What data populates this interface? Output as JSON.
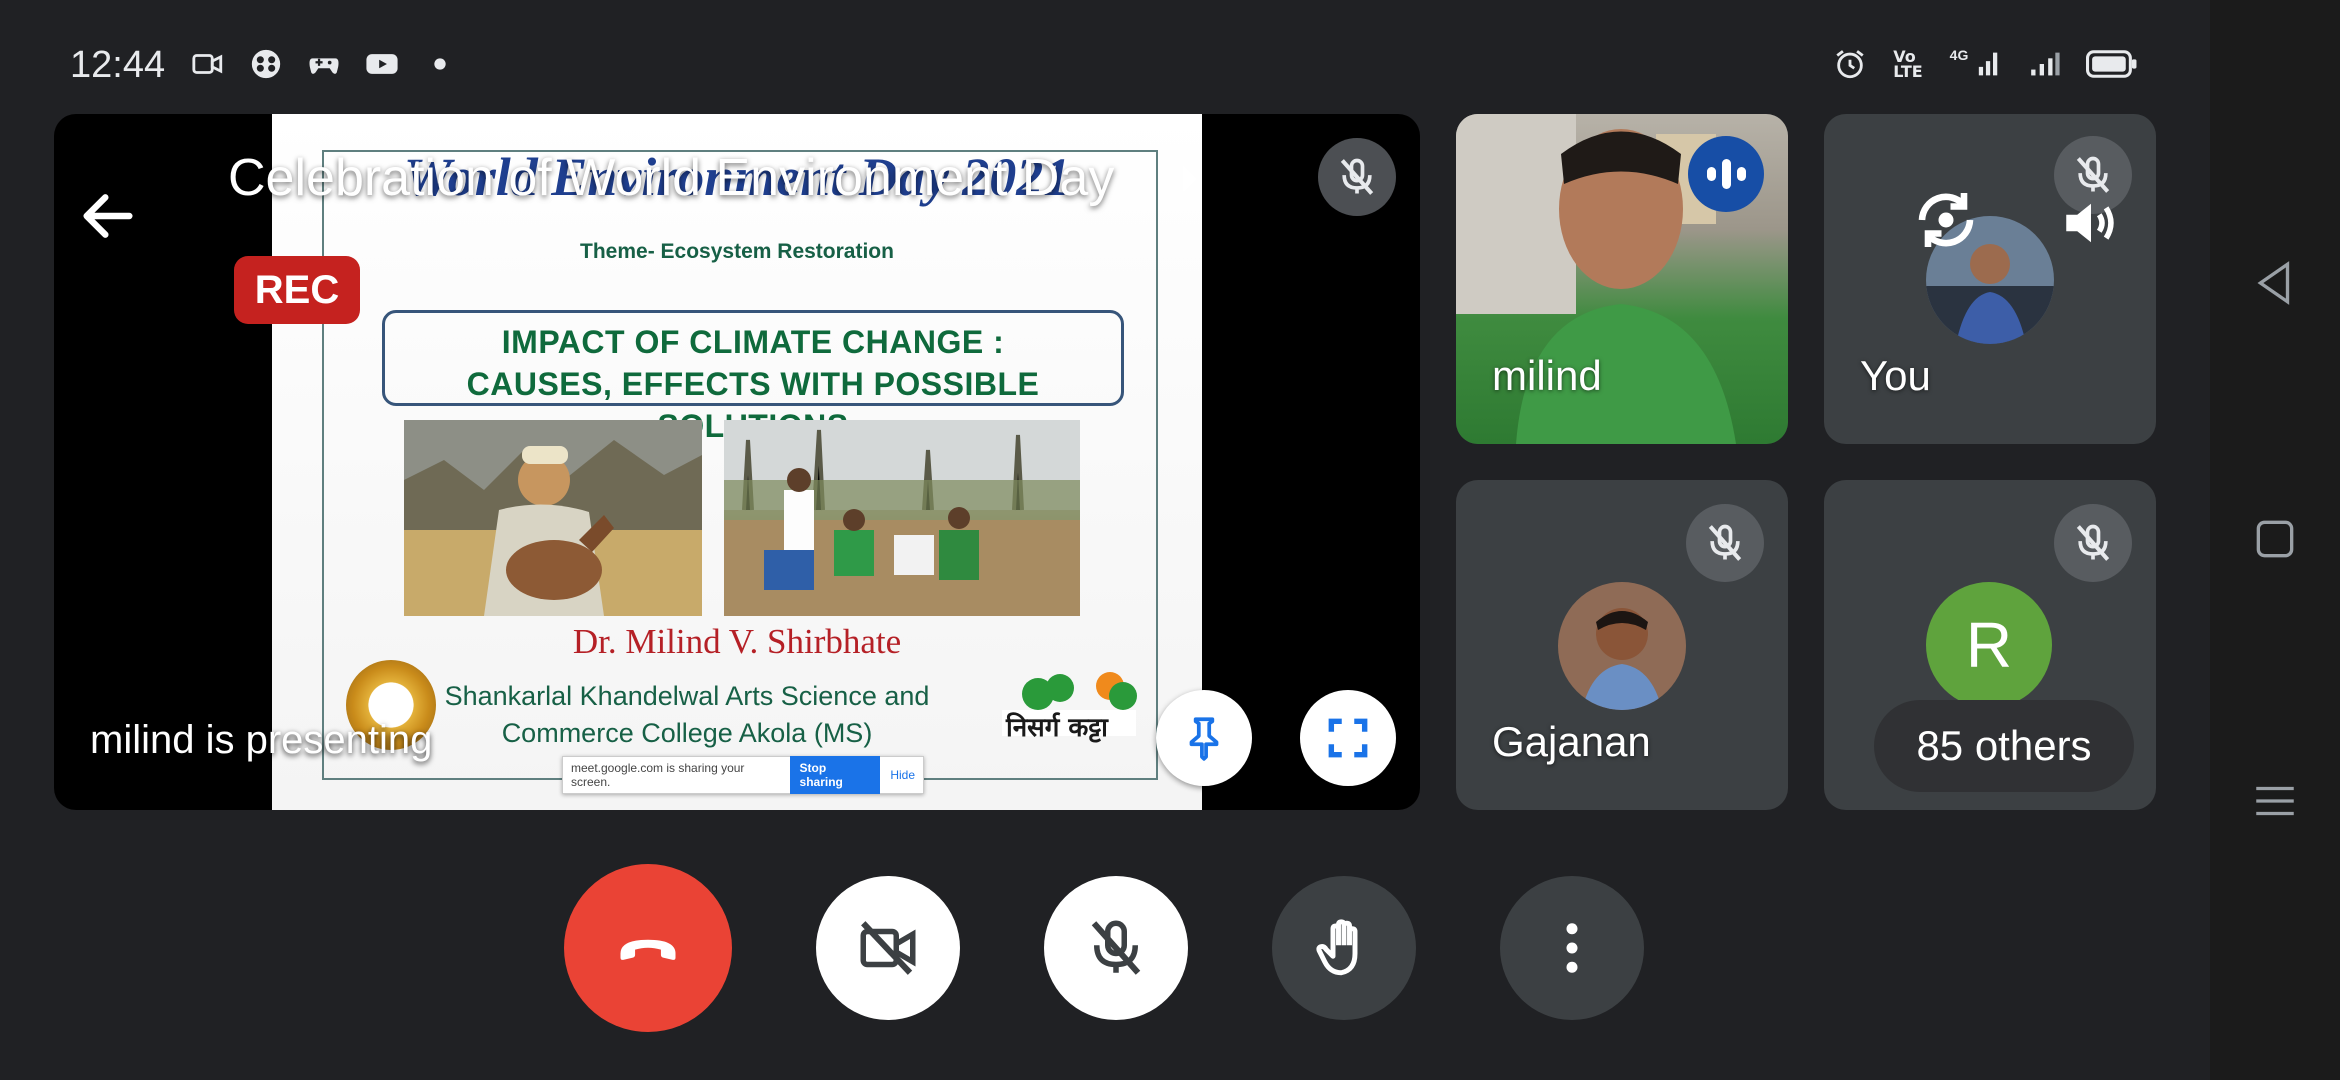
{
  "status_bar": {
    "time": "12:44",
    "lte_label": "Vo\nLTE",
    "network": "4G",
    "left_icons": [
      "video-icon",
      "game-icon",
      "gamepad-icon",
      "youtube-icon",
      "dot-icon"
    ],
    "right_icons": [
      "alarm-icon",
      "volte-icon",
      "signal-4g-icon",
      "signal-icon",
      "battery-icon"
    ]
  },
  "presentation": {
    "meeting_title": "Celebration of World Environment Day",
    "rec_label": "REC",
    "presenting_label": "milind is presenting",
    "slide": {
      "title": "World Environment Day 2021",
      "theme": "Theme- Ecosystem Restoration",
      "box_line1": "IMPACT OF CLIMATE CHANGE :",
      "box_line2": "CAUSES, EFFECTS WITH POSSIBLE SOLUTIONS",
      "presenter_name": "Dr. Milind V. Shirbhate",
      "college_line1": "Shankarlal Khandelwal Arts Science and",
      "college_line2": "Commerce College Akola (MS)",
      "logo_text": "निसर्ग कट्टा",
      "share_text": "meet.google.com is sharing your screen.",
      "stop_label": "Stop sharing",
      "hide_label": "Hide"
    }
  },
  "participants": [
    {
      "name": "milind",
      "state": "speaking"
    },
    {
      "name": "You",
      "state": "muted"
    },
    {
      "name": "Gajanan",
      "state": "muted"
    },
    {
      "name": "R",
      "avatar_letter": "R",
      "state": "muted"
    }
  ],
  "others_label": "85 others",
  "colors": {
    "end_call": "#ea4335",
    "rec": "#c5221f",
    "speaking": "#174ea6",
    "tile_bg": "#3c4043",
    "avatar_green": "#5fa33d",
    "accent_blue": "#1a73e8"
  }
}
